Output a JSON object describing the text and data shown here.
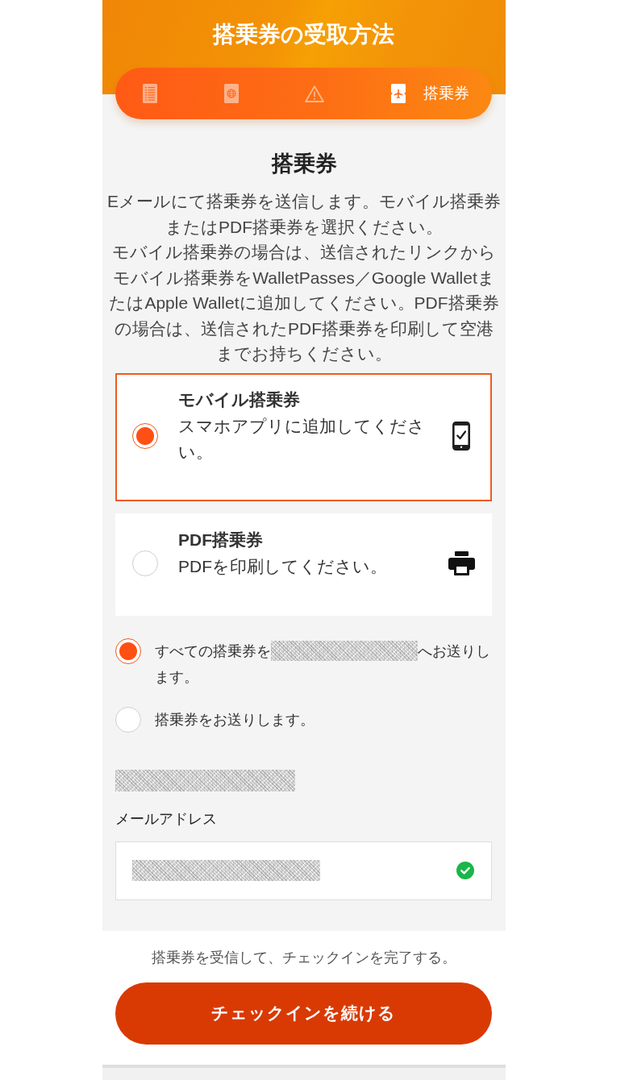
{
  "header": {
    "title": "搭乗券の受取方法"
  },
  "steps": [
    {
      "kind": "checklist",
      "selected": false
    },
    {
      "kind": "passport",
      "selected": false
    },
    {
      "kind": "warning",
      "selected": false
    },
    {
      "kind": "boarding-pass",
      "label": "搭乗券",
      "selected": true
    }
  ],
  "section": {
    "title": "搭乗券",
    "description": [
      "Eメールにて搭乗券を送信します。モバイル搭乗券またはPDF搭乗券を選択ください。",
      "モバイル搭乗券の場合は、送信されたリンクからモバイル搭乗券をWalletPasses／Google WalletまたはApple Walletに追加してください。PDF搭乗券の場合は、送信されたPDF搭乗券を印刷して空港までお持ちください。"
    ]
  },
  "ticket_options": [
    {
      "kind": "phone-check",
      "title": "モバイル搭乗券",
      "subtitle": "スマホアプリに追加してください。",
      "selected": true
    },
    {
      "kind": "printer",
      "title": "PDF搭乗券",
      "subtitle": "PDFを印刷してください。",
      "selected": false
    }
  ],
  "delivery_options": [
    {
      "parts": [
        {
          "kind": "text",
          "text": "すべての搭乗券を"
        },
        {
          "kind": "redacted"
        },
        {
          "kind": "text",
          "text": "へお送りします。"
        }
      ],
      "selected": true
    },
    {
      "parts": [
        {
          "kind": "text",
          "text": "搭乗券をお送りします。"
        }
      ],
      "selected": false
    }
  ],
  "email_section": {
    "heading_redacted": true,
    "label": "メールアドレス",
    "value_redacted": true,
    "valid": true
  },
  "footer": {
    "note": "搭乗券を受信して、チェックインを完了する。",
    "button": "チェックインを続ける"
  }
}
